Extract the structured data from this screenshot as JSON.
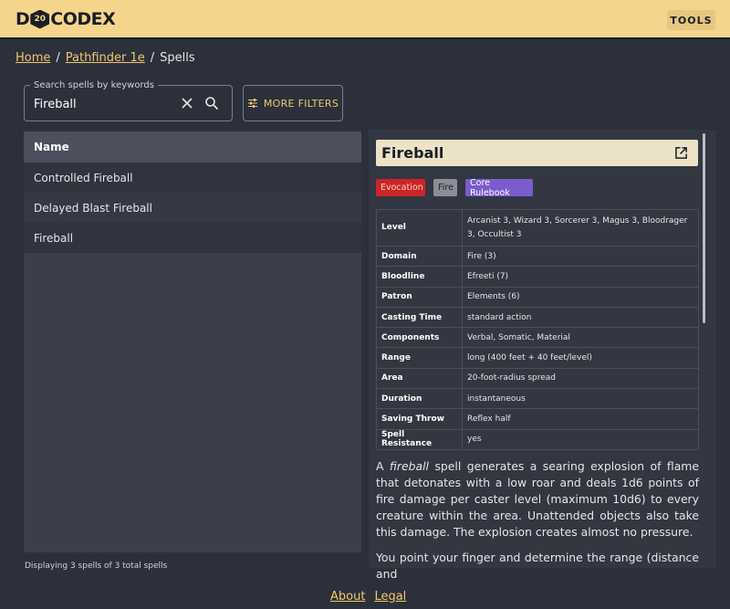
{
  "header": {
    "logo_left": "D",
    "logo_die": "20",
    "logo_right": "CODEX",
    "tools_label": "TOOLS",
    "bg_color": "#f5d58c"
  },
  "breadcrumb": {
    "home": "Home",
    "game": "Pathfinder 1e",
    "current": "Spells",
    "separator": "/"
  },
  "search": {
    "label": "Search spells by keywords",
    "value": "Fireball",
    "more_filters_label": "MORE FILTERS"
  },
  "list": {
    "header": "Name",
    "rows": [
      "Controlled Fireball",
      "Delayed Blast Fireball",
      "Fireball"
    ],
    "footer": "Displaying 3 spells of 3 total spells"
  },
  "detail": {
    "title": "Fireball",
    "tags": {
      "school": "Evocation",
      "descriptor": "Fire",
      "source": "Core Rulebook"
    },
    "properties": [
      {
        "key": "Level",
        "value": "Arcanist 3, Wizard 3, Sorcerer 3, Magus 3, Bloodrager 3, Occultist 3"
      },
      {
        "key": "Domain",
        "value": "Fire (3)"
      },
      {
        "key": "Bloodline",
        "value": "Efreeti (7)"
      },
      {
        "key": "Patron",
        "value": "Elements (6)"
      },
      {
        "key": "Casting Time",
        "value": "standard action"
      },
      {
        "key": "Components",
        "value": "Verbal, Somatic, Material"
      },
      {
        "key": "Range",
        "value": "long (400 feet + 40 feet/level)"
      },
      {
        "key": "Area",
        "value": "20-foot-radius spread"
      },
      {
        "key": "Duration",
        "value": "instantaneous"
      },
      {
        "key": "Saving Throw",
        "value": "Reflex half"
      },
      {
        "key": "Spell Resistance",
        "value": "yes"
      }
    ],
    "desc_prefix": "A ",
    "desc_italic": "fireball",
    "desc_rest": " spell generates a searing explosion of flame that detonates with a low roar and deals 1d6 points of fire damage per caster level (maximum 10d6) to every creature within the area. Unattended objects also take this damage. The explosion creates almost no pressure.",
    "desc_second": "You point your finger and determine the range (distance and"
  },
  "footer": {
    "about": "About",
    "legal": "Legal"
  }
}
